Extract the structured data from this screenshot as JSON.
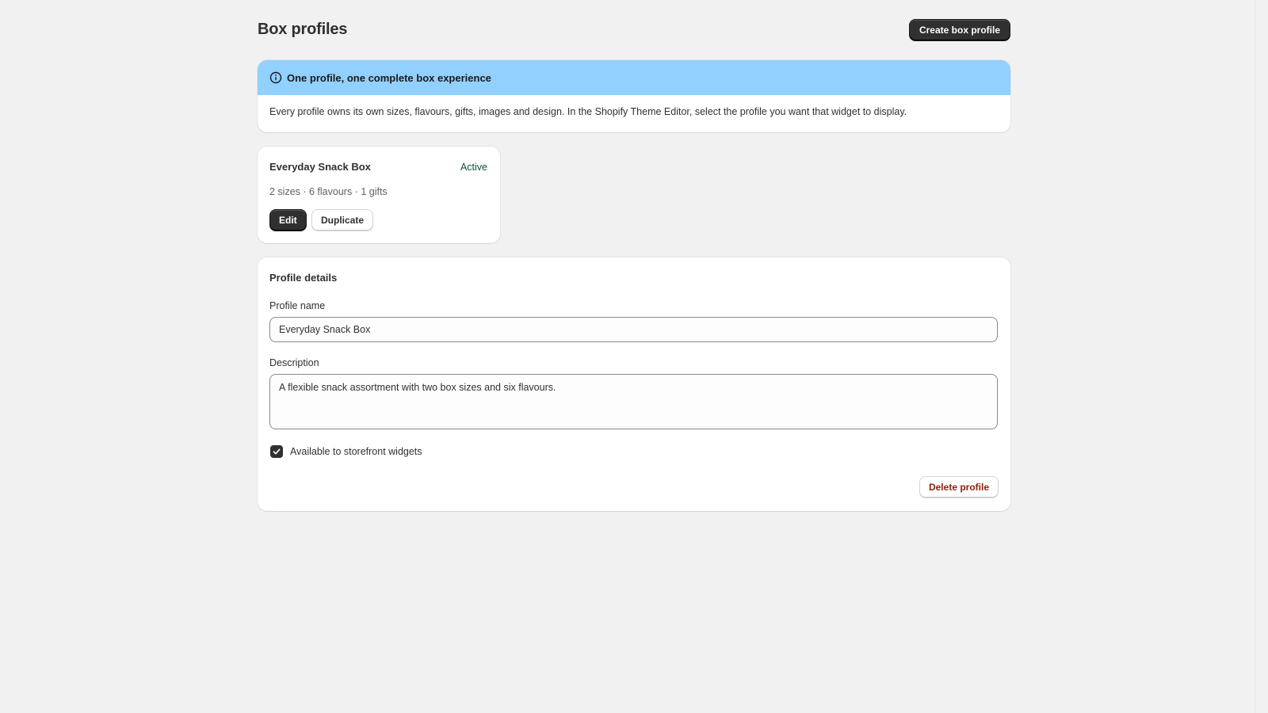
{
  "header": {
    "title": "Box profiles",
    "create_button_label": "Create box profile"
  },
  "banner": {
    "icon": "info-icon",
    "title": "One profile, one complete box experience",
    "body": "Every profile owns its own sizes, flavours, gifts, images and design. In the Shopify Theme Editor, select the profile you want that widget to display.",
    "color": "#91d0ff"
  },
  "profiles": [
    {
      "name": "Everyday Snack Box",
      "status": "Active",
      "meta": "2 sizes · 6 flavours · 1 gifts",
      "edit_label": "Edit",
      "duplicate_label": "Duplicate"
    }
  ],
  "details": {
    "title": "Profile details",
    "name_label": "Profile name",
    "name_value": "Everyday Snack Box",
    "description_label": "Description",
    "description_value": "A flexible snack assortment with two box sizes and six flavours.",
    "storefront_checkbox_label": "Available to storefront widgets",
    "storefront_checked": true,
    "delete_label": "Delete profile"
  },
  "colors": {
    "primary_button": "#303030",
    "active_status": "#0c5132",
    "delete_text": "#8e1f0b",
    "page_background": "#f1f1f1"
  }
}
